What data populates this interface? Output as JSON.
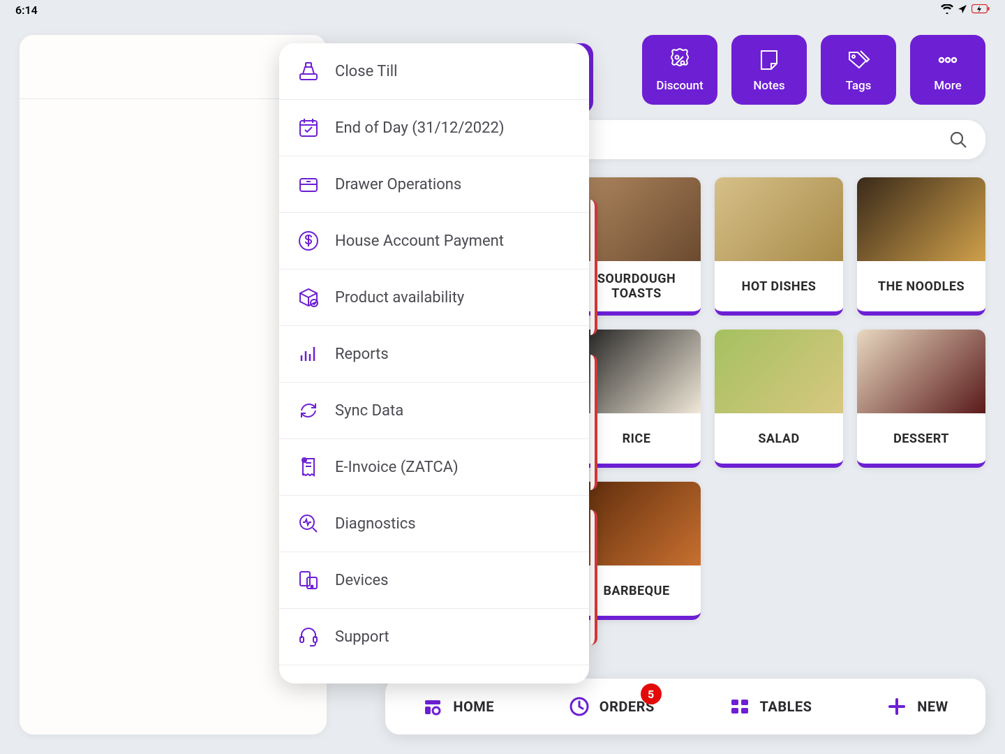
{
  "status": {
    "time": "6:14"
  },
  "actions": [
    {
      "label": "Discount",
      "icon": "discount"
    },
    {
      "label": "Notes",
      "icon": "notes"
    },
    {
      "label": "Tags",
      "icon": "tags"
    },
    {
      "label": "More",
      "icon": "more"
    }
  ],
  "products": [
    {
      "name": "SOURDOUGH TOASTS",
      "img": "toast"
    },
    {
      "name": "HOT DISHES",
      "img": "hot"
    },
    {
      "name": "THE NOODLES",
      "img": "noodle"
    },
    {
      "name": "RICE",
      "img": "rice"
    },
    {
      "name": "SALAD",
      "img": "salad"
    },
    {
      "name": "DESSERT",
      "img": "dessert"
    },
    {
      "name": "BARBEQUE",
      "img": "bbq"
    }
  ],
  "nav": {
    "home": "HOME",
    "orders": "ORDERS",
    "orders_badge": "5",
    "tables": "TABLES",
    "new": "NEW"
  },
  "menu": [
    {
      "label": "Close Till",
      "icon": "till"
    },
    {
      "label": "End of Day (31/12/2022)",
      "icon": "calendar"
    },
    {
      "label": "Drawer Operations",
      "icon": "drawer"
    },
    {
      "label": "House Account Payment",
      "icon": "dollar"
    },
    {
      "label": "Product availability",
      "icon": "box"
    },
    {
      "label": "Reports",
      "icon": "reports"
    },
    {
      "label": "Sync Data",
      "icon": "sync"
    },
    {
      "label": "E-Invoice (ZATCA)",
      "icon": "invoice"
    },
    {
      "label": "Diagnostics",
      "icon": "diag"
    },
    {
      "label": "Devices",
      "icon": "devices"
    },
    {
      "label": "Support",
      "icon": "support"
    }
  ]
}
